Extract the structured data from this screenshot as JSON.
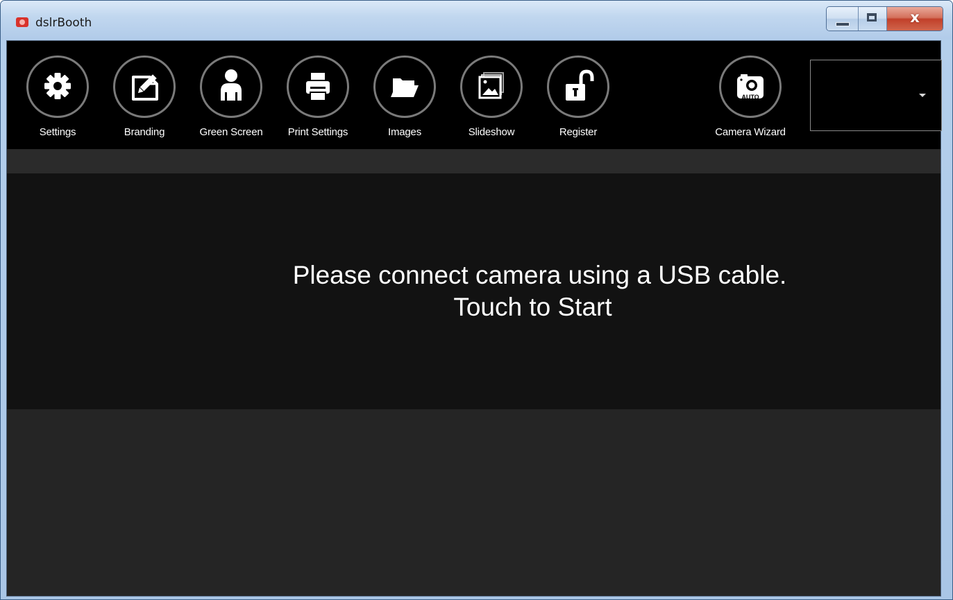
{
  "window": {
    "title": "dslrBooth"
  },
  "caption": {
    "close": "x"
  },
  "toolbar": {
    "items": [
      {
        "label": "Settings",
        "icon": "gear-icon"
      },
      {
        "label": "Branding",
        "icon": "branding-pencil-icon"
      },
      {
        "label": "Green Screen",
        "icon": "person-icon"
      },
      {
        "label": "Print Settings",
        "icon": "printer-icon"
      },
      {
        "label": "Images",
        "icon": "folder-icon"
      },
      {
        "label": "Slideshow",
        "icon": "slideshow-icon"
      },
      {
        "label": "Register",
        "icon": "unlocked-padlock-icon"
      }
    ],
    "camera_wizard": {
      "label": "Camera Wizard",
      "icon": "camera-auto-icon",
      "badge": "AUTO"
    },
    "camera_select": {
      "value": ""
    }
  },
  "main": {
    "message_line1": "Please connect camera using a USB cable.",
    "message_line2": "Touch to Start"
  },
  "colors": {
    "toolbar_bg": "#000000",
    "message_panel_bg": "#121212",
    "panel_bg": "#252525",
    "icon_ring": "#7a7a7a",
    "icon_fill": "#ffffff"
  }
}
